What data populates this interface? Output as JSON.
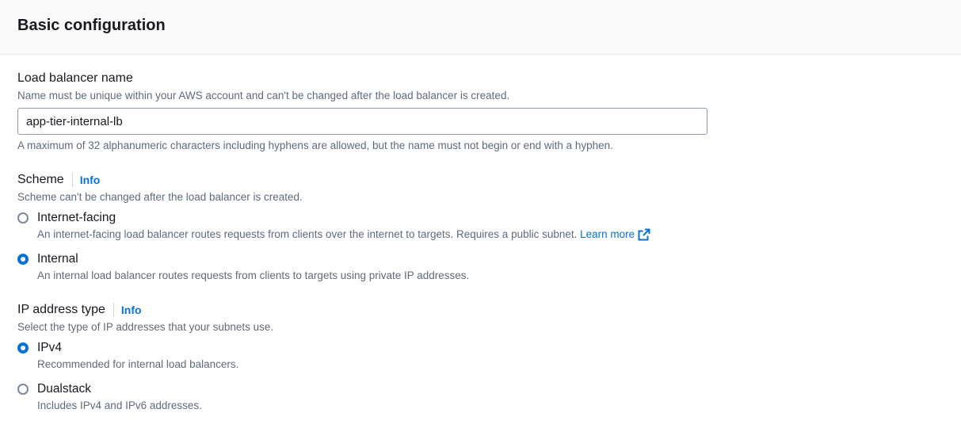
{
  "header": {
    "title": "Basic configuration"
  },
  "name_field": {
    "label": "Load balancer name",
    "description": "Name must be unique within your AWS account and can't be changed after the load balancer is created.",
    "value": "app-tier-internal-lb",
    "constraint": "A maximum of 32 alphanumeric characters including hyphens are allowed, but the name must not begin or end with a hyphen."
  },
  "scheme": {
    "label": "Scheme",
    "info_label": "Info",
    "description": "Scheme can't be changed after the load balancer is created.",
    "options": [
      {
        "label": "Internet-facing",
        "description": "An internet-facing load balancer routes requests from clients over the internet to targets. Requires a public subnet.",
        "link_label": "Learn more",
        "link_icon": "external-link-icon",
        "selected": false
      },
      {
        "label": "Internal",
        "description": "An internal load balancer routes requests from clients to targets using private IP addresses.",
        "selected": true
      }
    ]
  },
  "ip_type": {
    "label": "IP address type",
    "info_label": "Info",
    "description": "Select the type of IP addresses that your subnets use.",
    "options": [
      {
        "label": "IPv4",
        "description": "Recommended for internal load balancers.",
        "selected": true
      },
      {
        "label": "Dualstack",
        "description": "Includes IPv4 and IPv6 addresses.",
        "selected": false
      }
    ]
  },
  "colors": {
    "accent": "#0972d3",
    "text": "#16191f",
    "secondary_text": "#5f6b7a",
    "header_bg": "#fafafa"
  }
}
